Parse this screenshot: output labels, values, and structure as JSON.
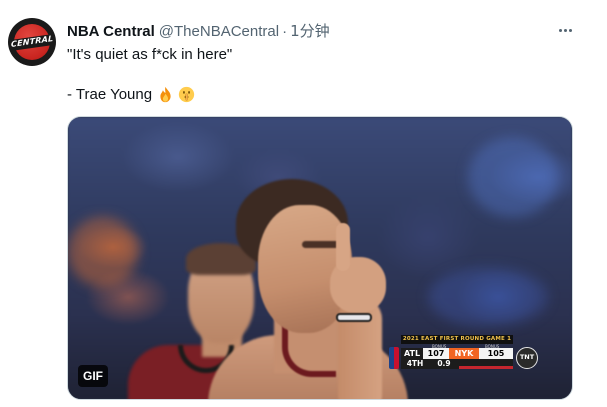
{
  "tweet": {
    "avatar_text": "CENTRAL",
    "display_name": "NBA Central",
    "handle": "@TheNBACentral",
    "separator": "·",
    "time": "1分钟",
    "text_line1": "\"It's quiet as f*ck in here\"",
    "text_line2": "- Trae Young",
    "emojis": [
      "fire-emoji",
      "shushing-face-emoji"
    ]
  },
  "media": {
    "badge": "GIF",
    "scoreboard": {
      "header": "2021 EAST FIRST ROUND  GAME 1",
      "bonus_left": "BONUS",
      "bonus_right": "BONUS",
      "team1": "ATL",
      "score1": "107",
      "team2": "NYK",
      "score2": "105",
      "period": "4TH",
      "clock": "0.9",
      "network": "TNT"
    }
  },
  "colors": {
    "text_primary": "#0f1419",
    "text_secondary": "#536471",
    "border": "#cfd9de",
    "nyk_orange": "#f26522",
    "hawks_red": "#7a1f25"
  }
}
